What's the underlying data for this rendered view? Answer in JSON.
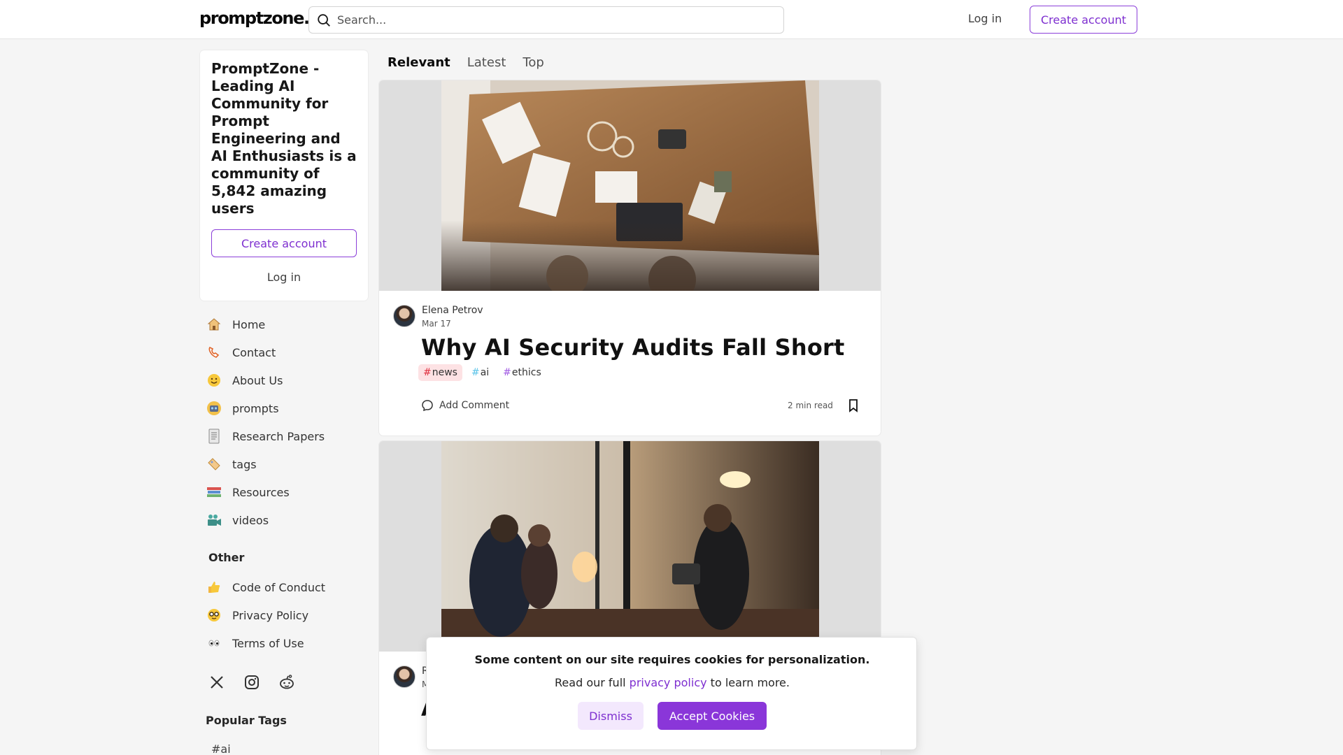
{
  "header": {
    "logo": "promptzone.",
    "search_placeholder": "Search...",
    "login_label": "Log in",
    "create_account_label": "Create account"
  },
  "intro": {
    "title": "PromptZone - Leading AI Community for Prompt Engineering and AI Enthusiasts is a community of 5,842 amazing users",
    "create_account_label": "Create account",
    "login_label": "Log in"
  },
  "nav": {
    "items": [
      {
        "label": "Home",
        "icon": "house-icon"
      },
      {
        "label": "Contact",
        "icon": "phone-icon"
      },
      {
        "label": "About Us",
        "icon": "smiley-icon"
      },
      {
        "label": "prompts",
        "icon": "robot-icon"
      },
      {
        "label": "Research Papers",
        "icon": "document-icon"
      },
      {
        "label": "tags",
        "icon": "tag-icon"
      },
      {
        "label": "Resources",
        "icon": "books-icon"
      },
      {
        "label": "videos",
        "icon": "video-camera-icon"
      }
    ],
    "other_title": "Other",
    "other_items": [
      {
        "label": "Code of Conduct",
        "icon": "thumbs-up-icon"
      },
      {
        "label": "Privacy Policy",
        "icon": "nerd-face-icon"
      },
      {
        "label": "Terms of Use",
        "icon": "eyes-icon"
      }
    ]
  },
  "social": [
    "x-icon",
    "instagram-icon",
    "reddit-icon"
  ],
  "popular_tags": {
    "title": "Popular Tags",
    "items": [
      "#ai"
    ]
  },
  "feed": {
    "tabs": [
      {
        "label": "Relevant",
        "active": true
      },
      {
        "label": "Latest",
        "active": false
      },
      {
        "label": "Top",
        "active": false
      }
    ]
  },
  "articles": [
    {
      "author": "Elena Petrov",
      "date": "Mar 17",
      "title": "Why AI Security Audits Fall Short",
      "tags": [
        "news",
        "ai",
        "ethics"
      ],
      "comment_label": "Add Comment",
      "read_time": "2 min read"
    },
    {
      "author": "R",
      "date": "M",
      "title": "A"
    }
  ],
  "cookie": {
    "title": "Some content on our site requires cookies for personalization.",
    "text_before": "Read our full",
    "link": "privacy policy",
    "text_after": "to learn more.",
    "dismiss_label": "Dismiss",
    "accept_label": "Accept Cookies"
  },
  "colors": {
    "accent": "#8a36d9",
    "accent_text": "#7e2fd0",
    "background": "#f5f5f5",
    "news_tag_bg": "#fde2e4",
    "ai_hash": "#59c3e8",
    "ethics_hash": "#a05ae3",
    "news_hash": "#e03140"
  }
}
